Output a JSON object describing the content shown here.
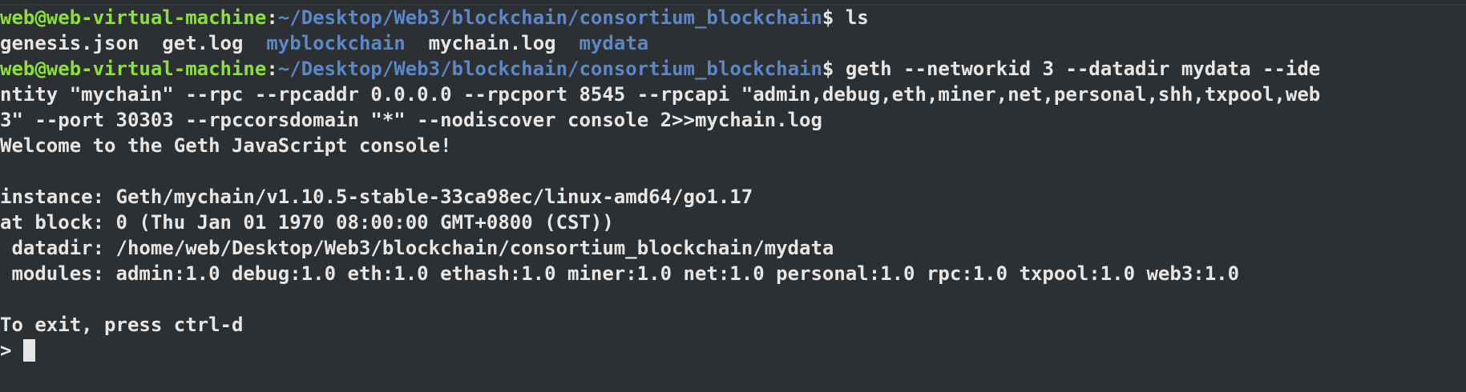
{
  "prompt1": {
    "user": "web@web-virtual-machine",
    "sep": ":",
    "path": "~/Desktop/Web3/blockchain/consortium_blockchain",
    "sym": "$ ",
    "cmd": "ls"
  },
  "ls_output": [
    {
      "text": "genesis.json",
      "type": "file"
    },
    {
      "text": "get.log",
      "type": "file"
    },
    {
      "text": "myblockchain",
      "type": "dir"
    },
    {
      "text": "mychain.log",
      "type": "file"
    },
    {
      "text": "mydata",
      "type": "dir"
    }
  ],
  "prompt2": {
    "user": "web@web-virtual-machine",
    "sep": ":",
    "path": "~/Desktop/Web3/blockchain/consortium_blockchain",
    "sym": "$ ",
    "cmd_part1": "geth --networkid 3 --datadir mydata --ide",
    "cmd_part2": "ntity \"mychain\" --rpc --rpcaddr 0.0.0.0 --rpcport 8545 --rpcapi \"admin,debug,eth,miner,net,personal,shh,txpool,web",
    "cmd_part3": "3\" --port 30303 --rpccorsdomain \"*\" --nodiscover console 2>>mychain.log"
  },
  "console": {
    "welcome": "Welcome to the Geth JavaScript console!",
    "instance": "instance: Geth/mychain/v1.10.5-stable-33ca98ec/linux-amd64/go1.17",
    "block": "at block: 0 (Thu Jan 01 1970 08:00:00 GMT+0800 (CST))",
    "datadir": " datadir: /home/web/Desktop/Web3/blockchain/consortium_blockchain/mydata",
    "modules": " modules: admin:1.0 debug:1.0 eth:1.0 ethash:1.0 miner:1.0 net:1.0 personal:1.0 rpc:1.0 txpool:1.0 web3:1.0",
    "exit_hint": "To exit, press ctrl-d",
    "prompt": "> "
  },
  "colors": {
    "background": "#2d3033",
    "user": "#8ae234",
    "path": "#5a87c9",
    "text": "#e6e6e6"
  }
}
